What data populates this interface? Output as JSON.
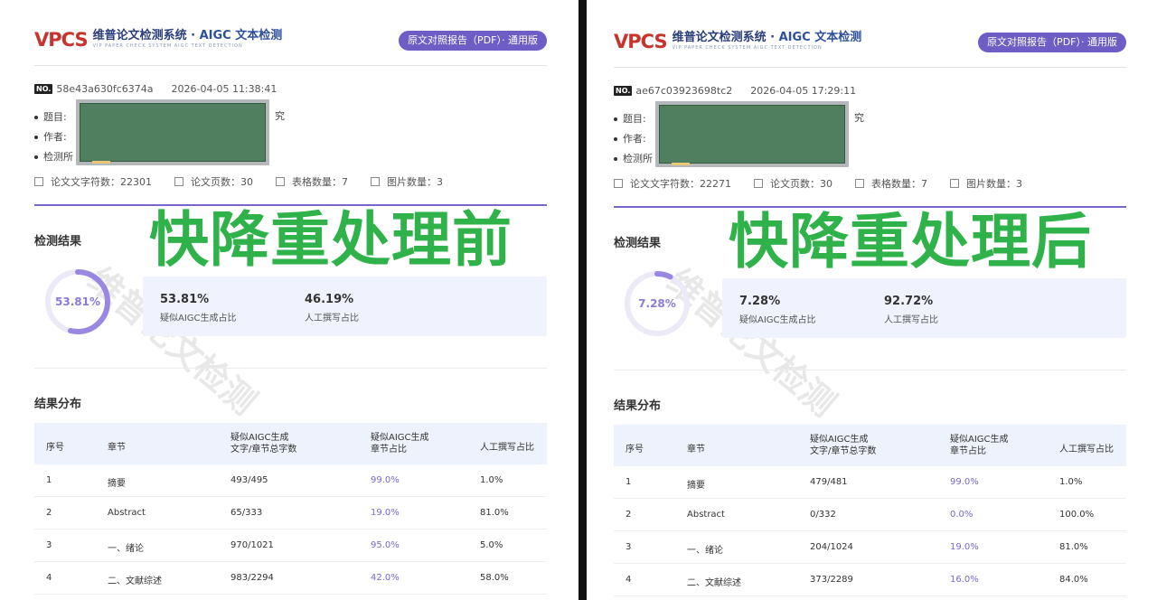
{
  "panels": [
    {
      "id": "left",
      "header": {
        "logo_mark": "VPCS",
        "title_part1": "维普论文检测系统 · ",
        "title_part2": "AIGC 文本检测",
        "subtitle": "VIP PAPER CHECK SYSTEM     AIGC TEXT DETECTION",
        "report_label": "原文对照报告（PDF）· 通用版"
      },
      "meta": {
        "no_badge": "NO.",
        "id": "58e43a630fc6374a",
        "timestamp": "2026-04-05 11:38:41"
      },
      "fields": {
        "title_label": "题目:",
        "author_label": "作者:",
        "institution_label": "检测所",
        "title_suffix": "究"
      },
      "stats": [
        {
          "label": "论文文字符数：22301",
          "icon": "text-count-icon"
        },
        {
          "label": "论文页数：30",
          "icon": "page-count-icon"
        },
        {
          "label": "表格数量：7",
          "icon": "table-icon"
        },
        {
          "label": "图片数量：3",
          "icon": "image-icon"
        }
      ],
      "overlay_text": "快降重处理前",
      "watermark": "维普论文检测",
      "result": {
        "section_title": "检测结果",
        "ring_label": "53.81%",
        "ring_fraction": 0.5381,
        "aigc_value": "53.81%",
        "aigc_label": "疑似AIGC生成占比",
        "human_value": "46.19%",
        "human_label": "人工撰写占比"
      },
      "distribution": {
        "section_title": "结果分布",
        "headers": [
          "序号",
          "章节",
          "疑似AIGC生成\n文字/章节总字数",
          "疑似AIGC生成\n章节占比",
          "人工撰写占比"
        ],
        "rows": [
          [
            "1",
            "摘要",
            "493/495",
            "99.0%",
            "1.0%"
          ],
          [
            "2",
            "Abstract",
            "65/333",
            "19.0%",
            "81.0%"
          ],
          [
            "3",
            "一、绪论",
            "970/1021",
            "95.0%",
            "5.0%"
          ],
          [
            "4",
            "二、文献综述",
            "983/2294",
            "42.0%",
            "58.0%"
          ]
        ]
      }
    },
    {
      "id": "right",
      "header": {
        "logo_mark": "VPCS",
        "title_part1": "维普论文检测系统 · ",
        "title_part2": "AIGC 文本检测",
        "subtitle": "VIP PAPER CHECK SYSTEM     AIGC TEXT DETECTION",
        "report_label": "原文对照报告（PDF）· 通用版"
      },
      "meta": {
        "no_badge": "NO.",
        "id": "ae67c03923698tc2",
        "timestamp": "2026-04-05 17:29:11"
      },
      "fields": {
        "title_label": "题目:",
        "author_label": "作者:",
        "institution_label": "检测所",
        "title_suffix": "究"
      },
      "stats": [
        {
          "label": "论文文字符数：22271",
          "icon": "text-count-icon"
        },
        {
          "label": "论文页数：30",
          "icon": "page-count-icon"
        },
        {
          "label": "表格数量：7",
          "icon": "table-icon"
        },
        {
          "label": "图片数量：3",
          "icon": "image-icon"
        }
      ],
      "overlay_text": "快降重处理后",
      "watermark": "维普论文检测",
      "result": {
        "section_title": "检测结果",
        "ring_label": "7.28%",
        "ring_fraction": 0.0728,
        "aigc_value": "7.28%",
        "aigc_label": "疑似AIGC生成占比",
        "human_value": "92.72%",
        "human_label": "人工撰写占比"
      },
      "distribution": {
        "section_title": "结果分布",
        "headers": [
          "序号",
          "章节",
          "疑似AIGC生成\n文字/章节总字数",
          "疑似AIGC生成\n章节占比",
          "人工撰写占比"
        ],
        "rows": [
          [
            "1",
            "摘要",
            "479/481",
            "99.0%",
            "1.0%"
          ],
          [
            "2",
            "Abstract",
            "0/332",
            "0.0%",
            "100.0%"
          ],
          [
            "3",
            "一、绪论",
            "204/1024",
            "19.0%",
            "81.0%"
          ],
          [
            "4",
            "二、文献综述",
            "373/2289",
            "16.0%",
            "84.0%"
          ]
        ]
      }
    }
  ]
}
